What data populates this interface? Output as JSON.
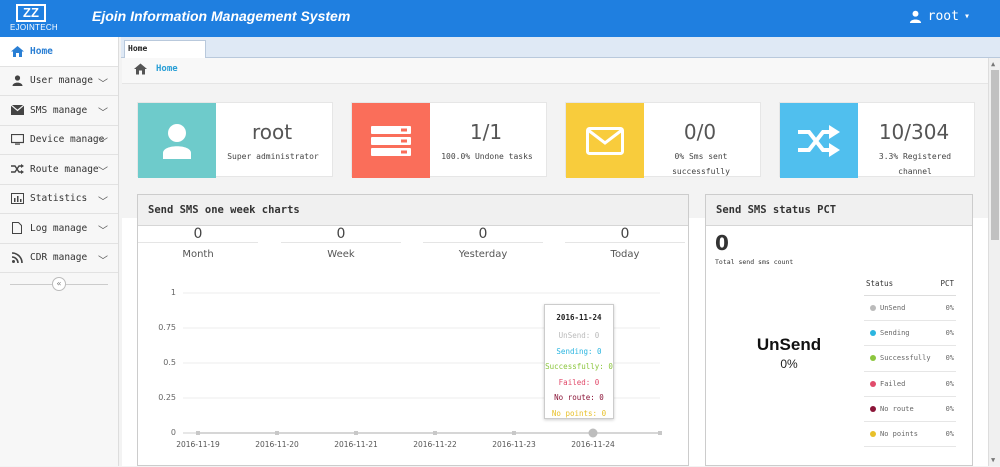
{
  "header": {
    "logo_mark": "ZZ",
    "logo_text": "EJOINTECH",
    "title": "Ejoin Information Management System",
    "user": "root"
  },
  "sidebar": {
    "items": [
      {
        "label": "Home",
        "icon": "home-icon"
      },
      {
        "label": "User manage",
        "icon": "user-icon"
      },
      {
        "label": "SMS manage",
        "icon": "envelope-icon"
      },
      {
        "label": "Device manage",
        "icon": "monitor-icon"
      },
      {
        "label": "Route manage",
        "icon": "shuffle-icon"
      },
      {
        "label": "Statistics",
        "icon": "bar-chart-icon"
      },
      {
        "label": "Log manage",
        "icon": "file-icon"
      },
      {
        "label": "CDR manage",
        "icon": "rss-icon"
      }
    ],
    "collapse": "«"
  },
  "tabs": [
    {
      "label": "Home"
    }
  ],
  "breadcrumb": {
    "label": "Home"
  },
  "stats": [
    {
      "value": "root",
      "desc": "Super administrator",
      "color": "#6ecbcb",
      "icon": "user-icon"
    },
    {
      "value": "1/1",
      "desc": "100.0% Undone tasks",
      "color": "#fa6e5a",
      "icon": "server-icon"
    },
    {
      "value": "0/0",
      "desc": "0% Sms sent successfully",
      "color": "#f8cc3c",
      "icon": "envelope-icon"
    },
    {
      "value": "10/304",
      "desc": "3.3% Registered channel",
      "color": "#50bfee",
      "icon": "shuffle-icon"
    }
  ],
  "week_panel": {
    "title": "Send SMS one week charts",
    "counts": [
      {
        "value": "0",
        "label": "Month"
      },
      {
        "value": "0",
        "label": "Week"
      },
      {
        "value": "0",
        "label": "Yesterday"
      },
      {
        "value": "0",
        "label": "Today"
      }
    ]
  },
  "chart_data": {
    "type": "line",
    "x": [
      "2016-11-19",
      "2016-11-20",
      "2016-11-21",
      "2016-11-22",
      "2016-11-23",
      "2016-11-24"
    ],
    "yticks": [
      "1",
      "0.75",
      "0.5",
      "0.25",
      "0"
    ],
    "ylim": [
      0,
      1
    ],
    "series": [
      {
        "name": "UnSend",
        "values": [
          0,
          0,
          0,
          0,
          0,
          0
        ],
        "color": "#bbbbbb"
      },
      {
        "name": "Sending",
        "values": [
          0,
          0,
          0,
          0,
          0,
          0
        ],
        "color": "#2bb5e0"
      },
      {
        "name": "Successfully",
        "values": [
          0,
          0,
          0,
          0,
          0,
          0
        ],
        "color": "#8cc63e"
      },
      {
        "name": "Failed",
        "values": [
          0,
          0,
          0,
          0,
          0,
          0
        ],
        "color": "#e14b6b"
      },
      {
        "name": "No route",
        "values": [
          0,
          0,
          0,
          0,
          0,
          0
        ],
        "color": "#8b1538"
      },
      {
        "name": "No points",
        "values": [
          0,
          0,
          0,
          0,
          0,
          0
        ],
        "color": "#e8c02a"
      }
    ],
    "tooltip": {
      "date": "2016-11-24",
      "rows": [
        {
          "text": "UnSend: 0",
          "color": "#bbbbbb"
        },
        {
          "text": "Sending: 0",
          "color": "#2bb5e0"
        },
        {
          "text": "Successfully: 0",
          "color": "#8cc63e"
        },
        {
          "text": "Failed: 0",
          "color": "#e14b6b"
        },
        {
          "text": "No route: 0",
          "color": "#8b1538"
        },
        {
          "text": "No points: 0",
          "color": "#e8c02a"
        }
      ]
    }
  },
  "status_panel": {
    "title": "Send SMS status PCT",
    "total": "0",
    "total_label": "Total send sms count",
    "center_label": "UnSend",
    "center_value": "0%",
    "col_status": "Status",
    "col_pct": "PCT",
    "rows": [
      {
        "name": "UnSend",
        "pct": "0%",
        "color": "#bbbbbb"
      },
      {
        "name": "Sending",
        "pct": "0%",
        "color": "#2bb5e0"
      },
      {
        "name": "Successfully",
        "pct": "0%",
        "color": "#8cc63e"
      },
      {
        "name": "Failed",
        "pct": "0%",
        "color": "#e14b6b"
      },
      {
        "name": "No route",
        "pct": "0%",
        "color": "#8b1538"
      },
      {
        "name": "No points",
        "pct": "0%",
        "color": "#e8c02a"
      }
    ]
  }
}
